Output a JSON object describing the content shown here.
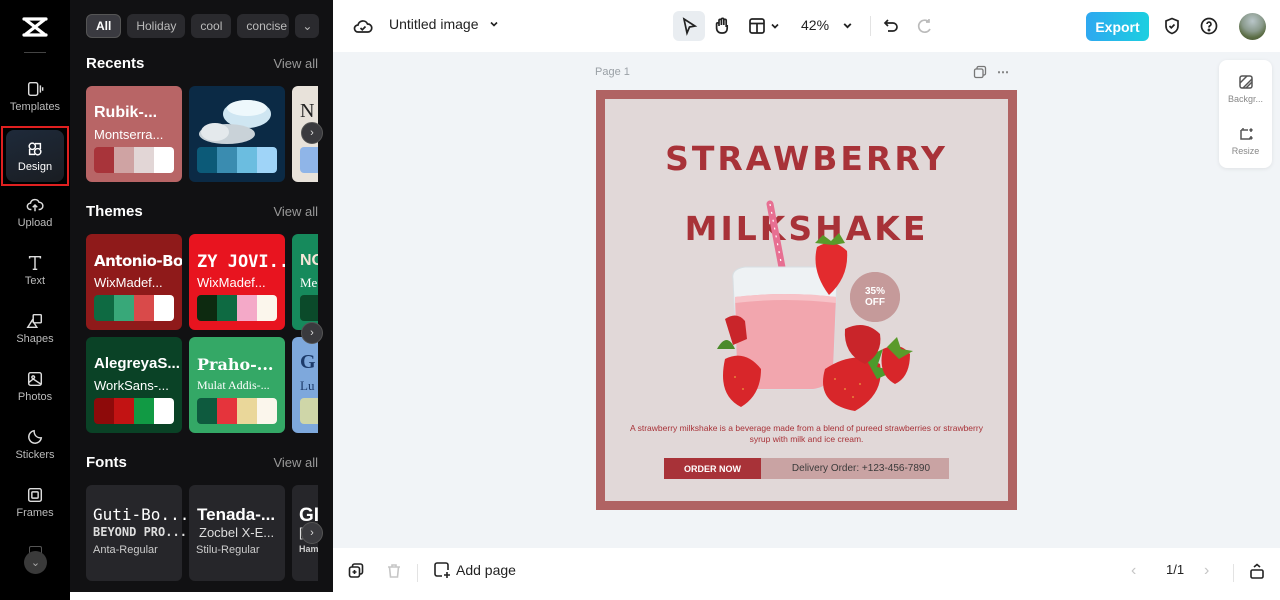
{
  "rail": {
    "items": [
      {
        "label": "Templates",
        "icon": "templates-icon"
      },
      {
        "label": "Design",
        "icon": "design-icon",
        "active": true
      },
      {
        "label": "Upload",
        "icon": "upload-icon"
      },
      {
        "label": "Text",
        "icon": "text-icon"
      },
      {
        "label": "Shapes",
        "icon": "shapes-icon"
      },
      {
        "label": "Photos",
        "icon": "photos-icon"
      },
      {
        "label": "Stickers",
        "icon": "stickers-icon"
      },
      {
        "label": "Frames",
        "icon": "frames-icon"
      }
    ],
    "more_icon": "⌄"
  },
  "panel": {
    "chips": [
      "All",
      "Holiday",
      "cool",
      "concise"
    ],
    "chips_more": "⌄",
    "view_all": "View all",
    "recents": {
      "title": "Recents",
      "cards": [
        {
          "title": "Rubik-...",
          "subtitle": "Montserra...",
          "bg": "#b86566",
          "swatches": [
            "#a8343a",
            "#cfa3a3",
            "#e2d6d6",
            "#ffffff"
          ]
        },
        {
          "title": "",
          "subtitle": "",
          "bg": "#0b2a45",
          "swatches": [
            "#0c5a78",
            "#3a8cb0",
            "#6bbde0",
            "#9fd4f8"
          ]
        },
        {
          "title": "N",
          "subtitle": "",
          "bg": "#e8e2da",
          "swatches": [
            "#8fb5e8"
          ]
        }
      ]
    },
    "themes": {
      "title": "Themes",
      "cards": [
        {
          "title": "Antonio-Bold",
          "subtitle": "WixMadef...",
          "bg": "#8f1a1a",
          "swatches": [
            "#0e6a42",
            "#38a879",
            "#d94a4a",
            "#ffffff"
          ]
        },
        {
          "title": "ZY JOVI...",
          "subtitle": "WixMadef...",
          "bg": "#e8141f",
          "swatches": [
            "#0d2a10",
            "#0e6a42",
            "#f4a9c8",
            "#fbf6ec"
          ]
        },
        {
          "title": "NO",
          "subtitle": "Me",
          "bg": "#168a5c",
          "swatches": [
            "#0b4a2a"
          ]
        },
        {
          "title": "AlegreyaS...",
          "subtitle": "WorkSans-...",
          "bg": "#0a4226",
          "swatches": [
            "#8e0a0a",
            "#c21313",
            "#119a44",
            "#ffffff"
          ]
        },
        {
          "title": "Praho-...",
          "subtitle": "Mulat Addis-...",
          "bg": "#34a866",
          "swatches": [
            "#0e5a3e",
            "#e5343c",
            "#ead79a",
            "#fbf6ec"
          ]
        },
        {
          "title": "G",
          "subtitle": "Lu",
          "bg": "#7ea8dc",
          "swatches": [
            "#cfd6a8"
          ]
        }
      ]
    },
    "fonts": {
      "title": "Fonts",
      "cards": [
        {
          "name": "Guti-Bo...",
          "sample": "BEYOND PRO...",
          "sub": "Anta-Regular"
        },
        {
          "name": "Tenada-...",
          "sample": "Zocbel X-E...",
          "sub": "Stilu-Regular"
        },
        {
          "name": "GI",
          "sample": "[",
          "sub": "Ham"
        }
      ]
    }
  },
  "topbar": {
    "doc_title": "Untitled image",
    "zoom": "42%",
    "export_label": "Export"
  },
  "canvas": {
    "page_label": "Page 1",
    "side_tools": [
      {
        "label": "Backgr...",
        "icon": "background-icon"
      },
      {
        "label": "Resize",
        "icon": "resize-icon"
      }
    ],
    "poster": {
      "title_line1": "STRAWBERRY",
      "title_line2": "MILKSHAKE",
      "badge_line1": "35%",
      "badge_line2": "OFF",
      "description": "A strawberry milkshake is a beverage made from a blend of pureed strawberries or strawberry syrup with milk and ice cream.",
      "order_label": "ORDER NOW",
      "delivery_text": "Delivery Order: +123-456-7890",
      "colors": {
        "frame": "#b06363",
        "background": "#e1d8d8",
        "accent": "#a83238"
      }
    }
  },
  "bottombar": {
    "add_page": "Add page",
    "pager": "1/1"
  }
}
